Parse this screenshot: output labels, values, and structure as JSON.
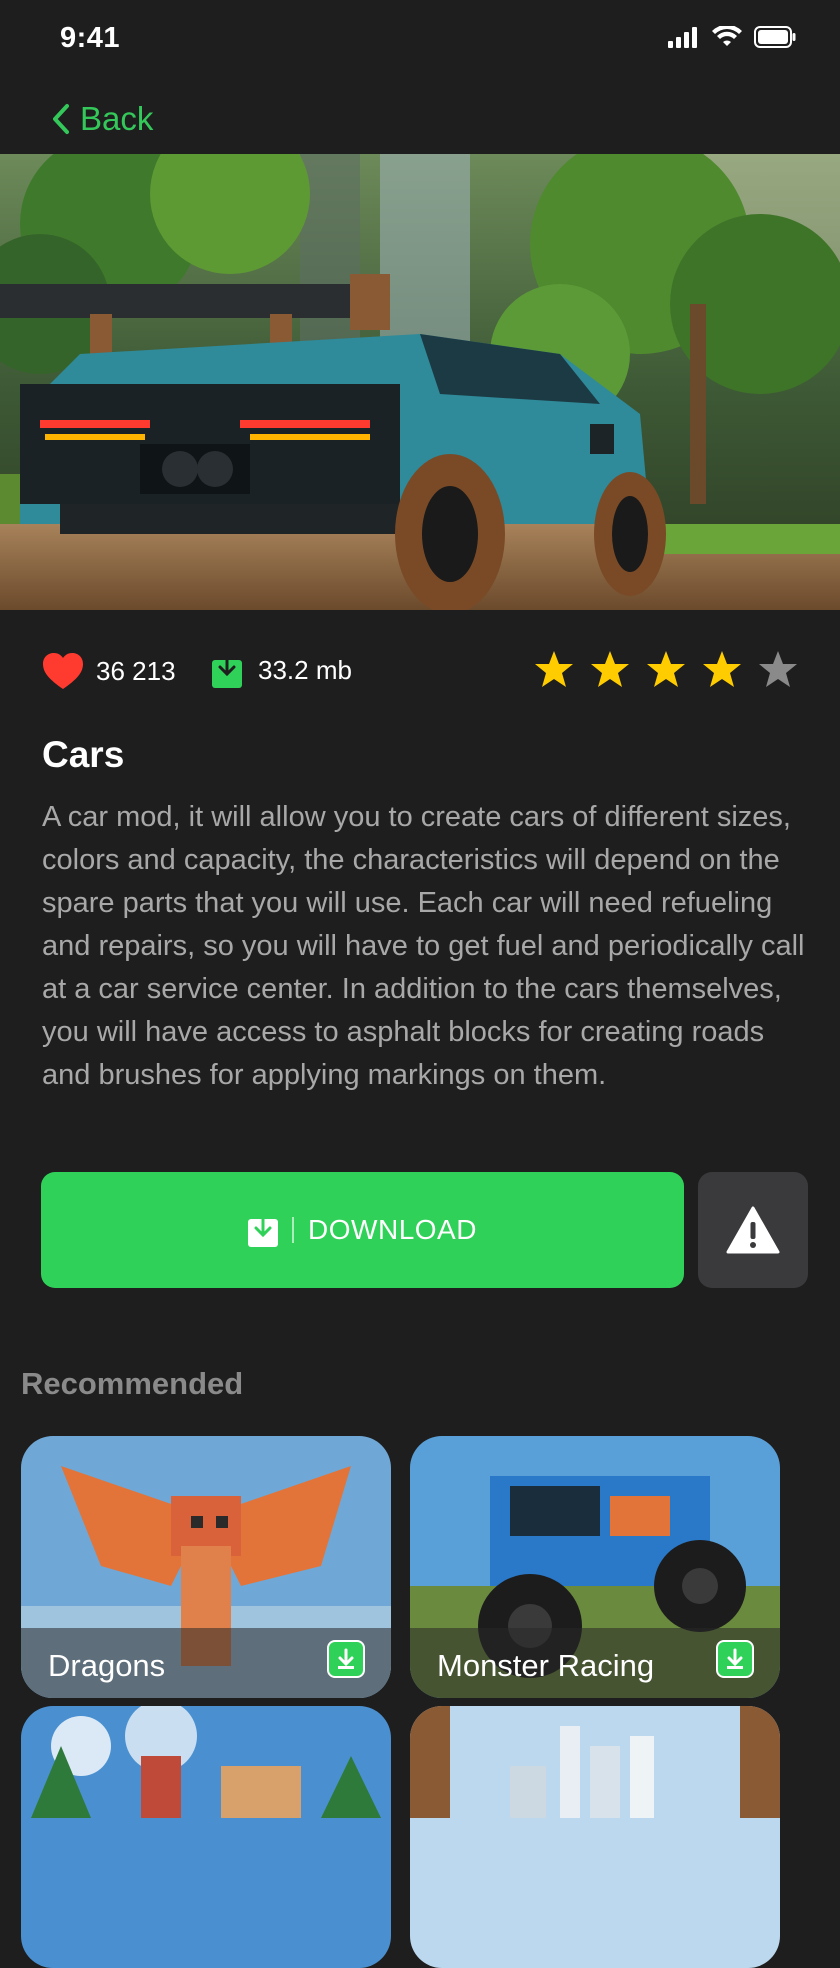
{
  "status": {
    "time": "9:41"
  },
  "nav": {
    "back_label": "Back"
  },
  "mod": {
    "likes": "36 213",
    "size": "33.2 mb",
    "rating": 4,
    "rating_max": 5,
    "title": "Cars",
    "description": "A car mod, it will allow you to create cars of different sizes, colors and capacity, the characteristics will depend on the spare parts that you will use. Each car will need refueling and repairs, so you will have to get fuel and periodically call at a car service center. In addition to the cars themselves, you will have access to asphalt blocks for creating roads and brushes for applying markings on them."
  },
  "actions": {
    "download_label": "DOWNLOAD"
  },
  "recommended": {
    "title": "Recommended",
    "items": [
      {
        "label": "Dragons"
      },
      {
        "label": "Monster Racing"
      }
    ]
  },
  "colors": {
    "accent": "#30d158",
    "background": "#1e1e1e",
    "star": "#ffcc00",
    "heart": "#ff3b30"
  }
}
